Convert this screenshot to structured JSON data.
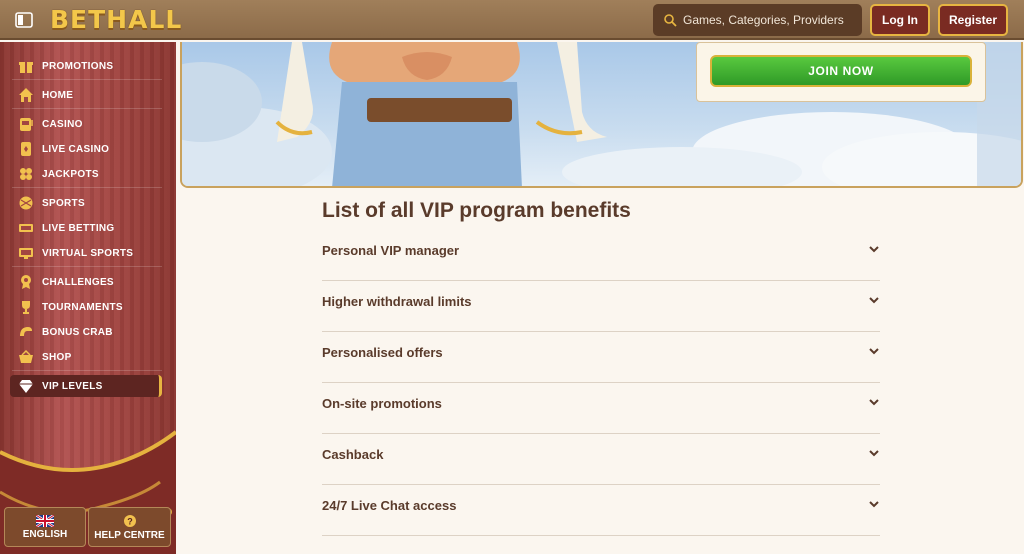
{
  "header": {
    "logo": "BETHALL",
    "search_placeholder": "Games, Categories, Providers",
    "login_label": "Log In",
    "register_label": "Register"
  },
  "sidebar": {
    "items": [
      {
        "label": "PROMOTIONS",
        "icon": "gift-icon"
      },
      {
        "label": "HOME",
        "icon": "home-icon"
      },
      {
        "label": "CASINO",
        "icon": "slot-machine-icon"
      },
      {
        "label": "LIVE CASINO",
        "icon": "card-icon"
      },
      {
        "label": "JACKPOTS",
        "icon": "clover-icon"
      },
      {
        "label": "SPORTS",
        "icon": "ball-icon"
      },
      {
        "label": "LIVE BETTING",
        "icon": "live-icon"
      },
      {
        "label": "VIRTUAL SPORTS",
        "icon": "virtual-icon"
      },
      {
        "label": "CHALLENGES",
        "icon": "medal-icon"
      },
      {
        "label": "TOURNAMENTS",
        "icon": "trophy-icon"
      },
      {
        "label": "BONUS CRAB",
        "icon": "crab-icon"
      },
      {
        "label": "SHOP",
        "icon": "basket-icon"
      },
      {
        "label": "VIP LEVELS",
        "icon": "diamond-icon",
        "active": true
      }
    ],
    "language": "ENGLISH",
    "help": "HELP CENTRE"
  },
  "banner": {
    "join_label": "JOIN NOW"
  },
  "content": {
    "title": "List of all VIP program benefits",
    "benefits": [
      "Personal VIP manager",
      "Higher withdrawal limits",
      "Personalised offers",
      "On-site promotions",
      "Cashback",
      "24/7 Live Chat access"
    ]
  },
  "colors": {
    "header_bg": "#8c6b49",
    "sidebar_bg": "#a24541",
    "accent_gold": "#e7b541",
    "join_green": "#3fae2f",
    "text_brown": "#5a3b2b"
  }
}
